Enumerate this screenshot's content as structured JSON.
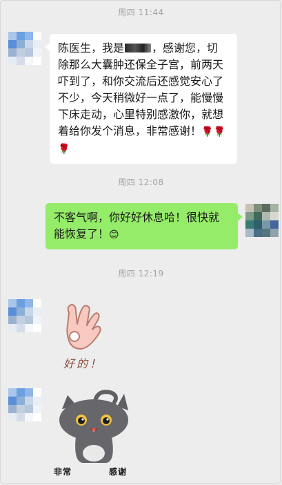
{
  "messages": [
    {
      "timestamp": "周四 11:44",
      "sender": "patient",
      "text_before": "陈医生，我是",
      "redacted_name_visible": false,
      "text_after": "，感谢您，切除那么大囊肿还保全子宫，前两天吓到了，和你交流后还感觉安心了不少，今天稍微好一点了，能慢慢下床走动，心里特别感激你，就想着给你发个消息，非常感谢！",
      "emojis": [
        "🌹",
        "🌹",
        "🌹"
      ]
    },
    {
      "timestamp": "周四 12:08",
      "sender": "doctor",
      "text": "不客气啊，你好好休息哈！很快就能恢复了！",
      "emoji": "😊"
    },
    {
      "timestamp": "周四 12:19",
      "sender": "patient",
      "sticker": "ok-hand-sticker",
      "sticker_caption": "好的！"
    },
    {
      "sender": "patient",
      "sticker": "gray-cat-sticker",
      "sticker_caption_left": "非常",
      "sticker_caption_right": "感谢"
    }
  ],
  "colors": {
    "background": "#ededed",
    "incoming_bubble": "#ffffff",
    "outgoing_bubble": "#95ec69",
    "timestamp_text": "#a3a3a3"
  }
}
